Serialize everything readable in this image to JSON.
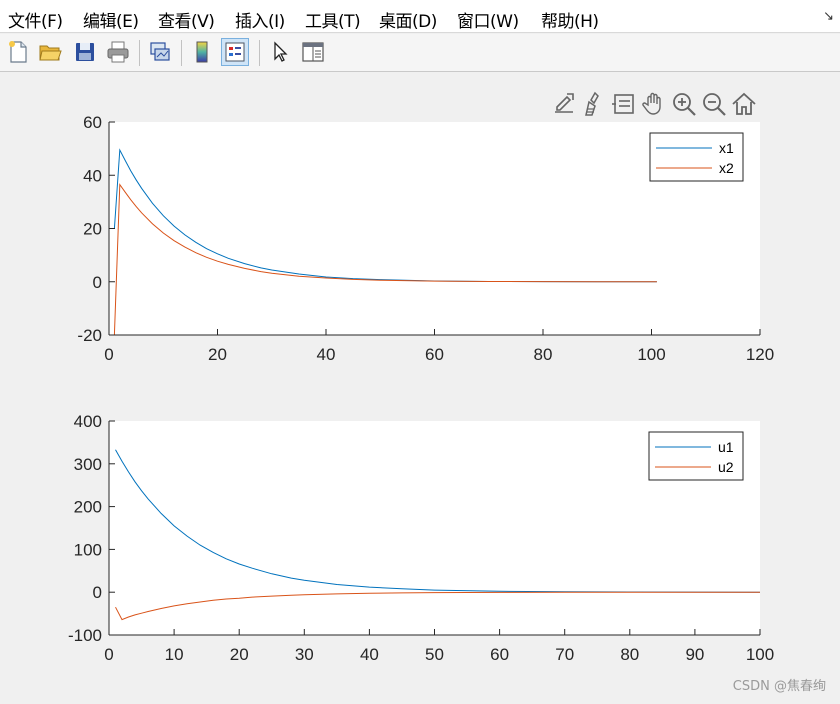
{
  "menu": [
    "文件(F)",
    "编辑(E)",
    "查看(V)",
    "插入(I)",
    "工具(T)",
    "桌面(D)",
    "窗口(W)",
    "帮助(H)"
  ],
  "menu_expand_icon": "↘",
  "toolbar_icons": [
    "new-file-icon",
    "open-folder-icon",
    "save-icon",
    "print-icon",
    "link-plot-icon",
    "colorbar-icon",
    "legend-icon",
    "pointer-icon",
    "property-inspector-icon"
  ],
  "axes_toolbar_icons": [
    "export-icon",
    "brush-icon",
    "data-tips-icon",
    "pan-icon",
    "zoom-in-icon",
    "zoom-out-icon",
    "home-icon"
  ],
  "colors": {
    "series1": "#0072bd",
    "series2": "#d95319",
    "axes_bg": "#ffffff",
    "figure_bg": "#f0f0f0"
  },
  "chart_data": [
    {
      "type": "line",
      "xlim": [
        0,
        120
      ],
      "ylim": [
        -20,
        60
      ],
      "xticks": [
        0,
        20,
        40,
        60,
        80,
        100,
        120
      ],
      "yticks": [
        -20,
        0,
        20,
        40,
        60
      ],
      "legend_position": "top-right",
      "grid": false,
      "series": [
        {
          "name": "x1",
          "color": "#0072bd",
          "x": [
            1,
            2,
            3,
            4,
            5,
            6,
            8,
            10,
            12,
            14,
            16,
            18,
            20,
            22,
            25,
            28,
            30,
            35,
            40,
            45,
            50,
            60,
            70,
            80,
            90,
            101
          ],
          "y": [
            20,
            49.5,
            45.5,
            41.7,
            38.3,
            35.1,
            29.5,
            24.8,
            20.9,
            17.6,
            14.8,
            12.4,
            10.5,
            8.8,
            6.8,
            5.2,
            4.4,
            2.9,
            1.8,
            1.2,
            0.8,
            0.3,
            0.1,
            0.05,
            0.02,
            0
          ]
        },
        {
          "name": "x2",
          "color": "#d95319",
          "x": [
            1,
            2,
            3,
            4,
            5,
            6,
            8,
            10,
            12,
            14,
            16,
            18,
            20,
            22,
            25,
            28,
            30,
            35,
            40,
            45,
            50,
            60,
            70,
            80,
            90,
            101
          ],
          "y": [
            -20,
            36.5,
            33.6,
            30.8,
            28.3,
            25.9,
            21.8,
            18.3,
            15.4,
            13,
            10.9,
            9.2,
            7.7,
            6.5,
            5,
            3.8,
            3.2,
            2.1,
            1.4,
            0.9,
            0.6,
            0.25,
            0.1,
            0.04,
            0.02,
            0
          ]
        }
      ]
    },
    {
      "type": "line",
      "xlim": [
        0,
        100
      ],
      "ylim": [
        -100,
        400
      ],
      "xticks": [
        0,
        10,
        20,
        30,
        40,
        50,
        60,
        70,
        80,
        90,
        100
      ],
      "yticks": [
        -100,
        0,
        100,
        200,
        300,
        400
      ],
      "legend_position": "top-right",
      "grid": false,
      "series": [
        {
          "name": "u1",
          "color": "#0072bd",
          "x": [
            1,
            2,
            3,
            4,
            5,
            6,
            8,
            10,
            12,
            14,
            16,
            18,
            20,
            22,
            25,
            28,
            30,
            35,
            40,
            45,
            50,
            60,
            70,
            80,
            90,
            100
          ],
          "y": [
            333,
            306,
            281,
            258,
            237,
            218,
            184,
            155,
            131,
            110,
            93,
            78,
            66,
            56,
            43,
            33,
            28,
            18,
            12,
            8,
            5,
            2,
            1,
            0.5,
            0.2,
            0
          ]
        },
        {
          "name": "u2",
          "color": "#d95319",
          "x": [
            1,
            2,
            3,
            4,
            5,
            6,
            8,
            10,
            12,
            14,
            16,
            18,
            20,
            22,
            25,
            28,
            30,
            35,
            40,
            45,
            50,
            60,
            70,
            80,
            90,
            100
          ],
          "y": [
            -35,
            -64,
            -58,
            -53,
            -49,
            -45,
            -38,
            -32,
            -27,
            -23,
            -19,
            -16,
            -14,
            -11.5,
            -9,
            -7,
            -6,
            -4,
            -2.5,
            -1.6,
            -1,
            -0.4,
            -0.15,
            -0.05,
            -0.02,
            0
          ]
        }
      ]
    }
  ],
  "watermark": "CSDN @焦春绚"
}
